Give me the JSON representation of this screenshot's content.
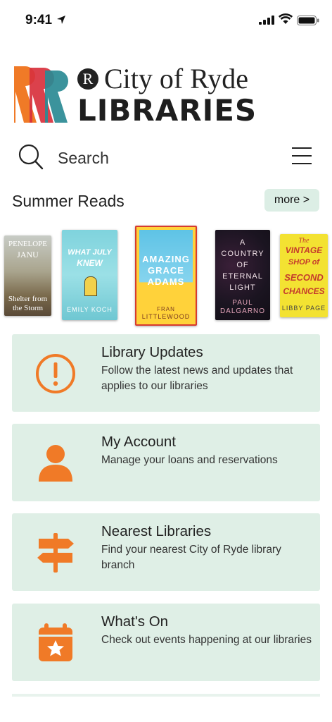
{
  "status_bar": {
    "time": "9:41"
  },
  "logo": {
    "city": "City of Ryde",
    "libraries": "LIBRARIES",
    "r_mark": "R"
  },
  "search": {
    "placeholder": "Search"
  },
  "summer_reads": {
    "title": "Summer Reads",
    "more_label": "more >",
    "books": [
      {
        "title_lines": [
          "PENELOPE",
          "JANU"
        ],
        "subtitle_lines": [
          "Shelter from",
          "the Storm"
        ]
      },
      {
        "title_lines": [
          "WHAT JULY",
          "KNEW"
        ],
        "author": "EMILY KOCH"
      },
      {
        "title_lines": [
          "AMAZING",
          "GRACE",
          "ADAMS"
        ],
        "author_lines": [
          "FRAN",
          "LITTLEWOOD"
        ]
      },
      {
        "title_lines": [
          "A",
          "COUNTRY",
          "OF",
          "ETERNAL",
          "LIGHT"
        ],
        "author_lines": [
          "PAUL",
          "DALGARNO"
        ]
      },
      {
        "title_lines": [
          "The",
          "VINTAGE",
          "SHOP of",
          "SECOND",
          "CHANCES"
        ],
        "author": "LIBBY PAGE"
      }
    ]
  },
  "cards": [
    {
      "title": "Library Updates",
      "desc": "Follow the latest news and updates that applies to our libraries",
      "icon": "alert-circle-icon"
    },
    {
      "title": "My Account",
      "desc": "Manage your loans and reservations",
      "icon": "user-icon"
    },
    {
      "title": "Nearest Libraries",
      "desc": "Find your nearest City of Ryde library branch",
      "icon": "signpost-icon"
    },
    {
      "title": "What's On",
      "desc": "Check out events happening at our libraries",
      "icon": "calendar-star-icon"
    }
  ],
  "colors": {
    "accent": "#f07a27",
    "card_bg": "#dfefe6",
    "logo_teal": "#2a8a94",
    "logo_red": "#d8313d"
  }
}
